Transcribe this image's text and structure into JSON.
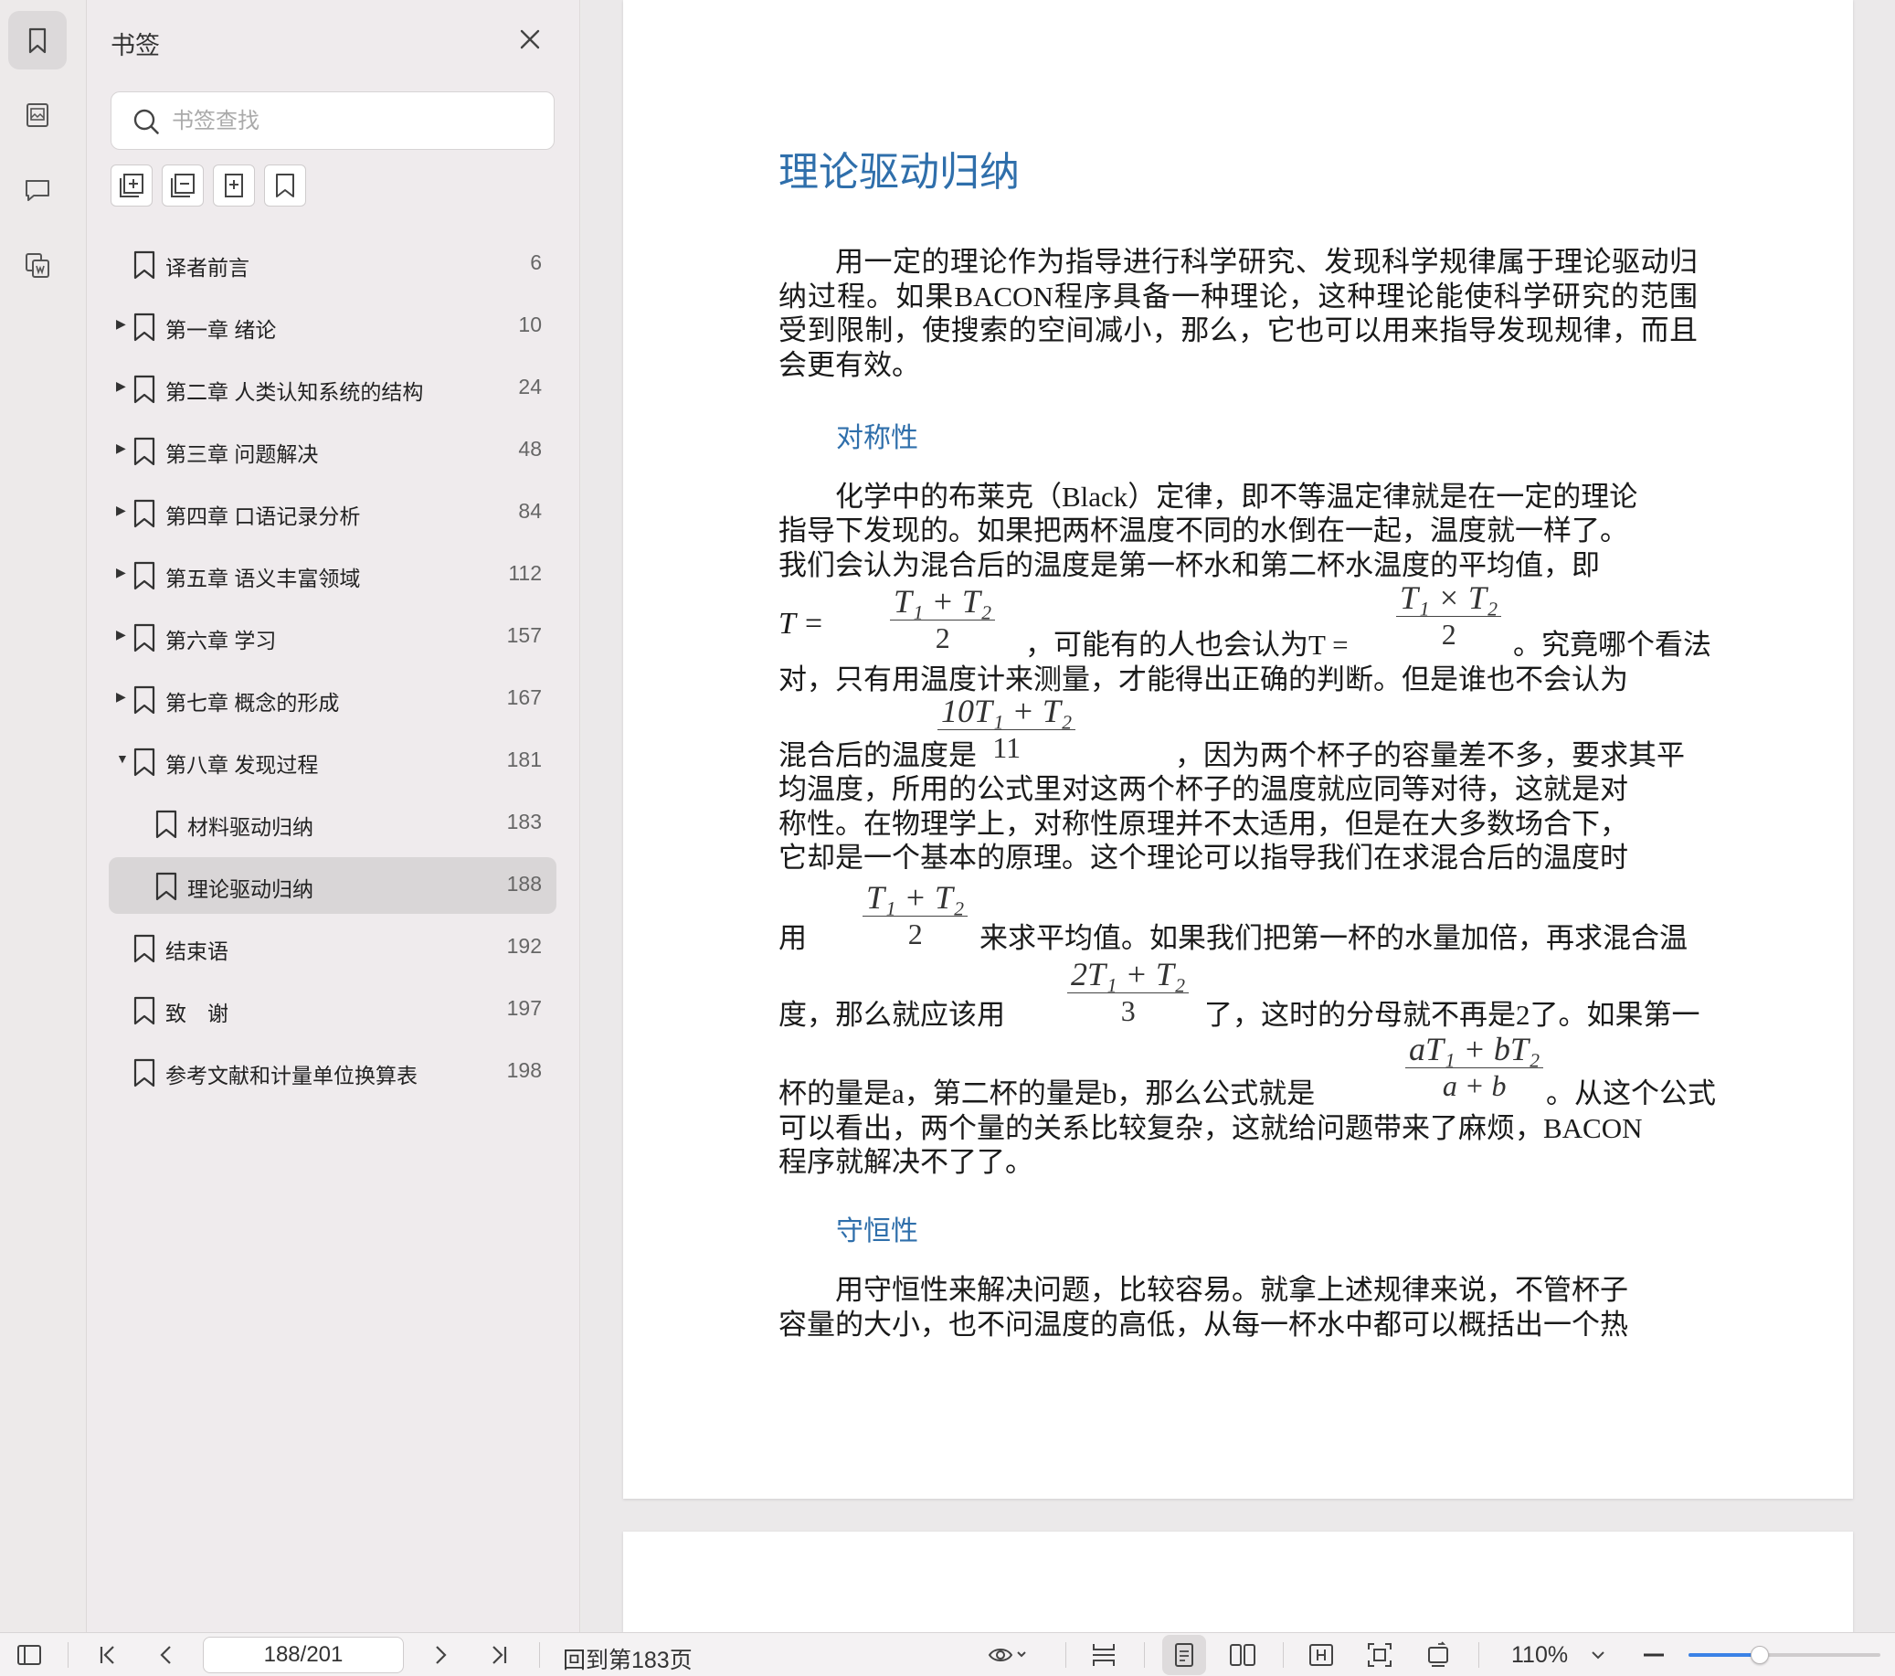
{
  "rail": {
    "items": [
      {
        "name": "bookmark-icon",
        "active": true
      },
      {
        "name": "thumbnail-icon",
        "active": false
      },
      {
        "name": "comment-icon",
        "active": false
      },
      {
        "name": "attachment-icon",
        "active": false
      }
    ]
  },
  "panel": {
    "title": "书签",
    "search_placeholder": "书签查找",
    "toolbar": [
      "expand-all-icon",
      "collapse-all-icon",
      "add-bookmark-icon",
      "bookmark-icon"
    ],
    "bookmarks": [
      {
        "label": "译者前言",
        "page": "6",
        "level": 0,
        "arrow": ""
      },
      {
        "label": "第一章 绪论",
        "page": "10",
        "level": 0,
        "arrow": "▶"
      },
      {
        "label": "第二章 人类认知系统的结构",
        "page": "24",
        "level": 0,
        "arrow": "▶"
      },
      {
        "label": "第三章 问题解决",
        "page": "48",
        "level": 0,
        "arrow": "▶"
      },
      {
        "label": "第四章 口语记录分析",
        "page": "84",
        "level": 0,
        "arrow": "▶"
      },
      {
        "label": "第五章 语义丰富领域",
        "page": "112",
        "level": 0,
        "arrow": "▶"
      },
      {
        "label": "第六章 学习",
        "page": "157",
        "level": 0,
        "arrow": "▶"
      },
      {
        "label": "第七章 概念的形成",
        "page": "167",
        "level": 0,
        "arrow": "▶"
      },
      {
        "label": "第八章 发现过程",
        "page": "181",
        "level": 0,
        "arrow": "▼"
      },
      {
        "label": "材料驱动归纳",
        "page": "183",
        "level": 1,
        "arrow": ""
      },
      {
        "label": "理论驱动归纳",
        "page": "188",
        "level": 1,
        "arrow": "",
        "selected": true
      },
      {
        "label": "结束语",
        "page": "192",
        "level": 0,
        "arrow": ""
      },
      {
        "label": "致　谢",
        "page": "197",
        "level": 0,
        "arrow": ""
      },
      {
        "label": "参考文献和计量单位换算表",
        "page": "198",
        "level": 0,
        "arrow": ""
      }
    ]
  },
  "document": {
    "title": "理论驱动归纳",
    "para1": "用一定的理论作为指导进行科学研究、发现科学规律属于理论驱动归纳过程。如果BACON程序具备一种理论，这种理论能使科学研究的范围受到限制，使搜索的空间减小，那么，它也可以用来指导发现规律，而且会更有效。",
    "sub1": "对称性",
    "p2_lines": [
      "化学中的布莱克（Black）定律，即不等温定律就是在一定的理论",
      "指导下发现的。如果把两杯温度不同的水倒在一起，温度就一样了。",
      "我们会认为混合后的温度是第一杯水和第二杯水温度的平均值，即"
    ],
    "p2_t_eq": "T =",
    "p2_mid1": "，可能有的人也会认为T =",
    "p2_end1": "。究竟哪个看法",
    "p2_line5": "对，只有用温度计来测量，才能得出正确的判断。但是谁也不会认为",
    "p2_line6a": "混合后的温度是",
    "p2_line6b": "，因为两个杯子的容量差不多，要求其平",
    "p2_lines2": [
      "均温度，所用的公式里对这两个杯子的温度就应同等对待，这就是对",
      "称性。在物理学上，对称性原理并不太适用，但是在大多数场合下，",
      "它却是一个基本的原理。这个理论可以指导我们在求混合后的温度时"
    ],
    "p2_line10a": "用",
    "p2_line10b": "来求平均值。如果我们把第一杯的水量加倍，再求混合温",
    "p2_line11a": "度，那么就应该用",
    "p2_line11b": "了，这时的分母就不再是2了。如果第一",
    "p2_line12a": "杯的量是a，第二杯的量是b，那么公式就是",
    "p2_line12b": "。从这个公式",
    "p2_line13": "可以看出，两个量的关系比较复杂，这就给问题带来了麻烦，BACON",
    "p2_line14": "程序就解决不了了。",
    "sub2": "守恒性",
    "p3_lines": [
      "用守恒性来解决问题，比较容易。就拿上述规律来说，不管杯子",
      "容量的大小，也不问温度的高低，从每一杯水中都可以概括出一个热"
    ],
    "formulas": {
      "f1": {
        "num": "T₁ + T₂",
        "den": "2"
      },
      "f2": {
        "num": "T₁ × T₂",
        "den": "2"
      },
      "f3": {
        "num": "10T₁ + T₂",
        "den": "11"
      },
      "f4": {
        "num": "T₁ + T₂",
        "den": "2"
      },
      "f5": {
        "num": "2T₁ + T₂",
        "den": "3"
      },
      "f6": {
        "num": "aT₁ + bT₂",
        "den": "a + b"
      }
    }
  },
  "statusbar": {
    "page_value": "188/201",
    "back_link": "回到第183页",
    "zoom": "110%",
    "zoom_level": 0.37,
    "accent": "#3b82e6"
  }
}
